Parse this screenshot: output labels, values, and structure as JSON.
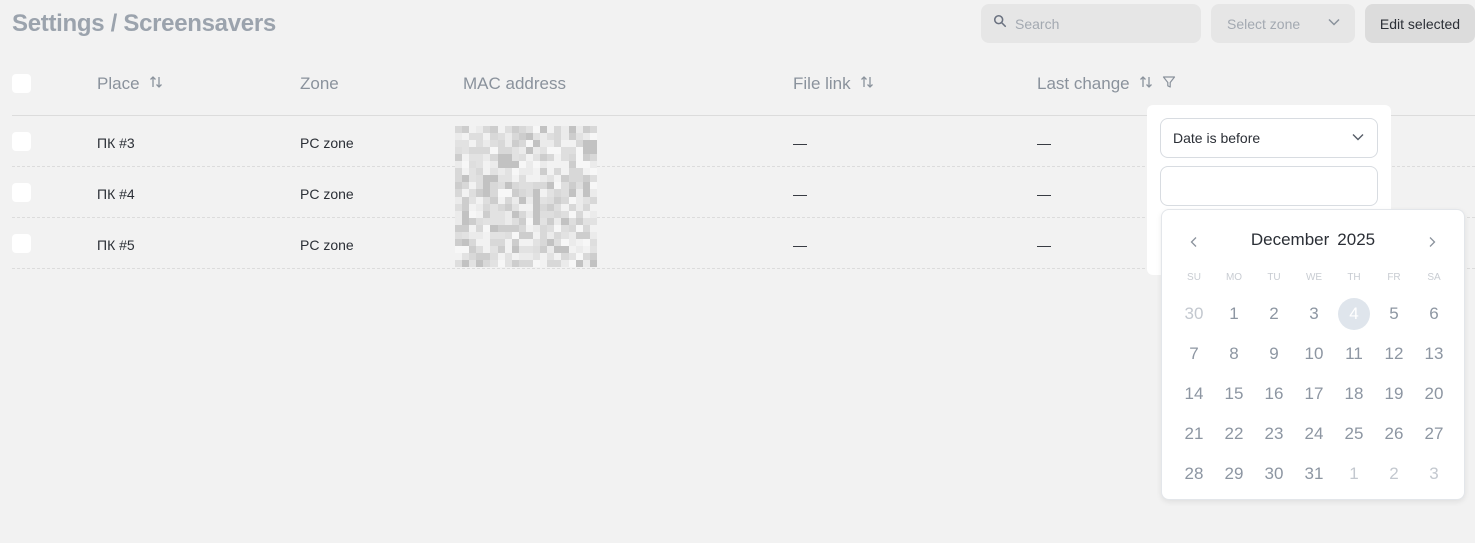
{
  "header": {
    "title": "Settings / Screensavers",
    "search_placeholder": "Search",
    "zone_select_label": "Select zone",
    "edit_button": "Edit selected"
  },
  "table": {
    "columns": {
      "place": "Place",
      "zone": "Zone",
      "mac": "MAC address",
      "file_link": "File link",
      "last_change": "Last change"
    },
    "rows": [
      {
        "place": "ПК #3",
        "zone": "PC zone",
        "file_link": "—",
        "last_change": "—"
      },
      {
        "place": "ПК #4",
        "zone": "PC zone",
        "file_link": "—",
        "last_change": "—"
      },
      {
        "place": "ПК #5",
        "zone": "PC zone",
        "file_link": "—",
        "last_change": "—"
      }
    ]
  },
  "filter": {
    "condition": "Date is before",
    "value": ""
  },
  "calendar": {
    "month": "December",
    "year": "2025",
    "weekdays": [
      "SU",
      "MO",
      "TU",
      "WE",
      "TH",
      "FR",
      "SA"
    ],
    "days": [
      {
        "d": "30",
        "muted": true
      },
      {
        "d": "1"
      },
      {
        "d": "2"
      },
      {
        "d": "3"
      },
      {
        "d": "4",
        "today": true
      },
      {
        "d": "5"
      },
      {
        "d": "6"
      },
      {
        "d": "7"
      },
      {
        "d": "8"
      },
      {
        "d": "9"
      },
      {
        "d": "10"
      },
      {
        "d": "11"
      },
      {
        "d": "12"
      },
      {
        "d": "13"
      },
      {
        "d": "14"
      },
      {
        "d": "15"
      },
      {
        "d": "16"
      },
      {
        "d": "17"
      },
      {
        "d": "18"
      },
      {
        "d": "19"
      },
      {
        "d": "20"
      },
      {
        "d": "21"
      },
      {
        "d": "22"
      },
      {
        "d": "23"
      },
      {
        "d": "24"
      },
      {
        "d": "25"
      },
      {
        "d": "26"
      },
      {
        "d": "27"
      },
      {
        "d": "28"
      },
      {
        "d": "29"
      },
      {
        "d": "30"
      },
      {
        "d": "31"
      },
      {
        "d": "1",
        "muted": true
      },
      {
        "d": "2",
        "muted": true
      },
      {
        "d": "3",
        "muted": true
      }
    ]
  },
  "icons": {
    "search": "search-icon",
    "chevron": "chevron-down-icon",
    "sort": "sort-icon",
    "filter": "filter-icon",
    "prev": "chevron-left-icon",
    "next": "chevron-right-icon"
  },
  "colors": {
    "background": "#f2f2f2",
    "title": "#9ba3ad",
    "today_highlight": "#dfe5ec"
  }
}
